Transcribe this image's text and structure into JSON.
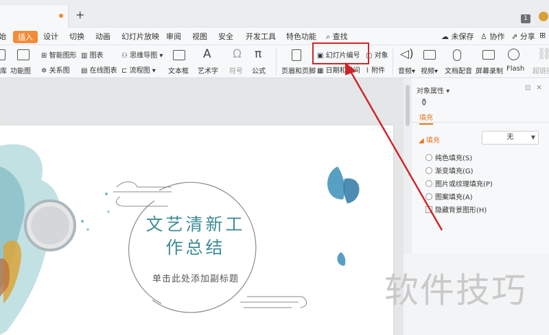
{
  "tabbar": {
    "new_tab": "+",
    "tab_count": "1"
  },
  "menu": {
    "items": [
      "始",
      "插入",
      "设计",
      "切换",
      "动画",
      "幻灯片放映",
      "审阅",
      "视图",
      "安全",
      "开发工具",
      "特色功能"
    ],
    "search_label": "查找",
    "unsaved_label": "未保存",
    "collab_label": "协作",
    "share_label": "分享"
  },
  "ribbon": {
    "library": "库",
    "function_chart": "功能图",
    "smart_shape": "智能图形",
    "relation_chart": "关系图",
    "chart": "图表",
    "online_chart": "在线图表",
    "mind_map": "思维导图",
    "flow_chart": "流程图",
    "textbox": "文本框",
    "art_text": "艺术字",
    "symbol": "符号",
    "formula": "公式",
    "header_footer": "页眉和页脚",
    "slide_number": "幻灯片编号",
    "datetime": "日期和时间",
    "object": "对象",
    "attachment": "附件",
    "audio": "音频",
    "video": "视频",
    "doc_dubbing": "文档配音",
    "screen_record": "屏幕录制",
    "flash": "Flash",
    "hyperlink": "超链接"
  },
  "slide": {
    "title_line1": "文艺清新工",
    "title_line2": "作总结",
    "subtitle": "单击此处添加副标题"
  },
  "pane": {
    "title": "对象属性",
    "fill_tab": "填充",
    "section": "填充",
    "fill_value": "无",
    "options": [
      "纯色填充(S)",
      "渐变填充(G)",
      "图片或纹理填充(P)",
      "图案填充(A)"
    ],
    "hide_bg": "隐藏背景图形(H)"
  },
  "watermark": "软件技巧",
  "colors": {
    "accent": "#f38c38",
    "highlight": "#d0242a",
    "title": "#3e8c95"
  }
}
